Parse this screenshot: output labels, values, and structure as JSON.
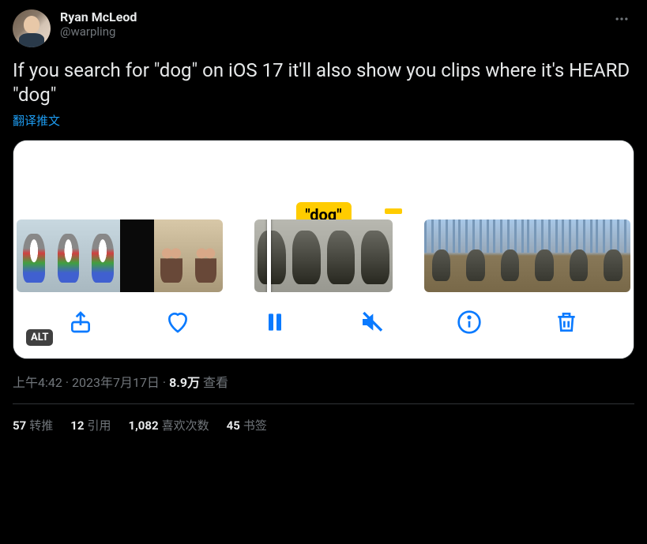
{
  "author": {
    "display_name": "Ryan McLeod",
    "handle": "@warpling"
  },
  "tweet_text": "If you search for \"dog\" on iOS 17 it'll also show you clips where it's HEARD \"dog\"",
  "translate_label": "翻译推文",
  "media": {
    "highlight_label": "\"dog\"",
    "alt_badge": "ALT"
  },
  "meta": {
    "time": "上午4:42",
    "dot1": " · ",
    "date": "2023年7月17日",
    "dot2": " · ",
    "views_count": "8.9万",
    "views_label": " 查看"
  },
  "stats": {
    "retweets_count": "57",
    "retweets_label": "转推",
    "quotes_count": "12",
    "quotes_label": "引用",
    "likes_count": "1,082",
    "likes_label": "喜欢次数",
    "bookmarks_count": "45",
    "bookmarks_label": "书签"
  }
}
